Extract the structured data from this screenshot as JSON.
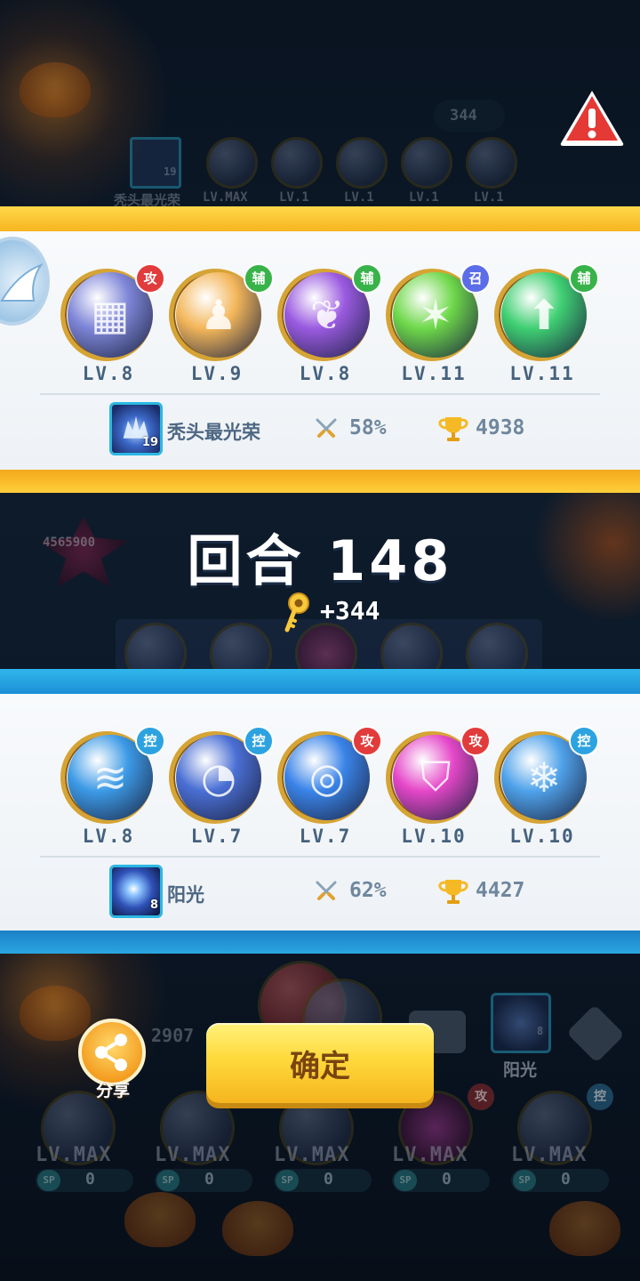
{
  "background": {
    "top_keys": "344",
    "top_player_name": "秃头最光荣",
    "top_player_level": "19",
    "top_skill_levels": [
      "LV.MAX",
      "LV.1",
      "LV.1",
      "LV.1",
      "LV.1"
    ],
    "left_score": "4565900",
    "bottom_score": "2907",
    "bottom_player_name": "阳光",
    "bottom_player_level": "8",
    "bottom_skill_levels": [
      "LV.MAX",
      "LV.MAX",
      "LV.MAX",
      "LV.MAX",
      "LV.MAX"
    ],
    "sp_tag": "SP",
    "sp_values": [
      "0",
      "0",
      "0",
      "0",
      "0"
    ],
    "bottom_badges": [
      "攻",
      "控"
    ]
  },
  "round": {
    "title": "回合 148",
    "reward": "+344"
  },
  "players": [
    {
      "name": "秃头最光荣",
      "avatar_level": "19",
      "win_rate": "58%",
      "trophies": "4938",
      "theme": "gold",
      "skills": [
        {
          "type": "攻",
          "level": "LV.8",
          "color": "#7f86d8",
          "badge_color": "#e23b3b",
          "icon": "maze-icon"
        },
        {
          "type": "辅",
          "level": "LV.9",
          "color": "#f3b65a",
          "badge_color": "#38b34a",
          "icon": "people-icon"
        },
        {
          "type": "辅",
          "level": "LV.8",
          "color": "#9a5ae0",
          "badge_color": "#38b34a",
          "icon": "leaf-icon"
        },
        {
          "type": "召",
          "level": "LV.11",
          "color": "#6ed84a",
          "badge_color": "#5b6de8",
          "icon": "star-ring-icon"
        },
        {
          "type": "辅",
          "level": "LV.11",
          "color": "#3fcf72",
          "badge_color": "#38b34a",
          "icon": "arrow-up-icon"
        }
      ]
    },
    {
      "name": "阳光",
      "avatar_level": "8",
      "win_rate": "62%",
      "trophies": "4427",
      "theme": "blue",
      "skills": [
        {
          "type": "控",
          "level": "LV.8",
          "color": "#3c9ae6",
          "badge_color": "#2ca3e0",
          "icon": "wave-icon"
        },
        {
          "type": "控",
          "level": "LV.7",
          "color": "#4a6fd4",
          "badge_color": "#2ca3e0",
          "icon": "clock-icon"
        },
        {
          "type": "攻",
          "level": "LV.7",
          "color": "#3a84e8",
          "badge_color": "#e23b3b",
          "icon": "swirl-icon"
        },
        {
          "type": "攻",
          "level": "LV.10",
          "color": "#e547c8",
          "badge_color": "#e23b3b",
          "icon": "shield-crack-icon"
        },
        {
          "type": "控",
          "level": "LV.10",
          "color": "#4fa2ea",
          "badge_color": "#2ca3e0",
          "icon": "snowflake-icon"
        }
      ]
    }
  ],
  "buttons": {
    "confirm": "确定",
    "share": "分享"
  }
}
